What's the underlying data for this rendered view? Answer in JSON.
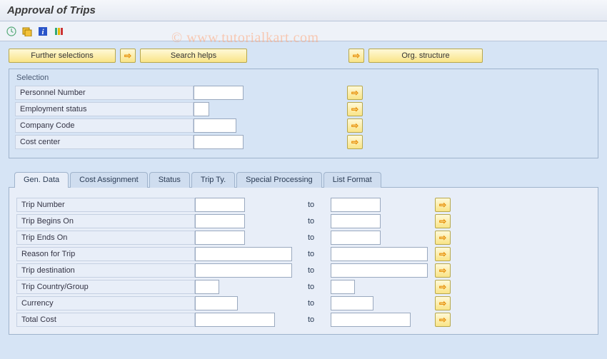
{
  "title": "Approval of Trips",
  "watermark": "© www.tutorialkart.com",
  "toolbar_icons": [
    "clock-icon",
    "execute-icon",
    "info-icon",
    "variant-icon"
  ],
  "buttons": {
    "further_selections": "Further selections",
    "search_helps": "Search helps",
    "org_structure": "Org. structure"
  },
  "selection": {
    "title": "Selection",
    "fields": [
      {
        "label": "Personnel Number",
        "value": "",
        "width": "w70"
      },
      {
        "label": "Employment status",
        "value": "",
        "width": "w22"
      },
      {
        "label": "Company Code",
        "value": "",
        "width": "w60"
      },
      {
        "label": "Cost center",
        "value": "",
        "width": "w70"
      }
    ]
  },
  "tabs": [
    "Gen. Data",
    "Cost Assignment",
    "Status",
    "Trip Ty.",
    "Special Processing",
    "List Format"
  ],
  "active_tab": 0,
  "gen_data": {
    "to_label": "to",
    "rows": [
      {
        "label": "Trip Number",
        "from": "",
        "to": "",
        "from_w": "w70",
        "to_w": "w70"
      },
      {
        "label": "Trip Begins On",
        "from": "",
        "to": "",
        "from_w": "w70",
        "to_w": "w70"
      },
      {
        "label": "Trip Ends On",
        "from": "",
        "to": "",
        "from_w": "w70",
        "to_w": "w70"
      },
      {
        "label": "Reason for Trip",
        "from": "",
        "to": "",
        "from_w": "w120",
        "to_w": "w120"
      },
      {
        "label": "Trip destination",
        "from": "",
        "to": "",
        "from_w": "w120",
        "to_w": "w120"
      },
      {
        "label": "Trip Country/Group",
        "from": "",
        "to": "",
        "from_w": "w34",
        "to_w": "w34"
      },
      {
        "label": "Currency",
        "from": "",
        "to": "",
        "from_w": "w60",
        "to_w": "w60"
      },
      {
        "label": "Total Cost",
        "from": "",
        "to": "",
        "from_w": "w112",
        "to_w": "w112"
      }
    ]
  }
}
